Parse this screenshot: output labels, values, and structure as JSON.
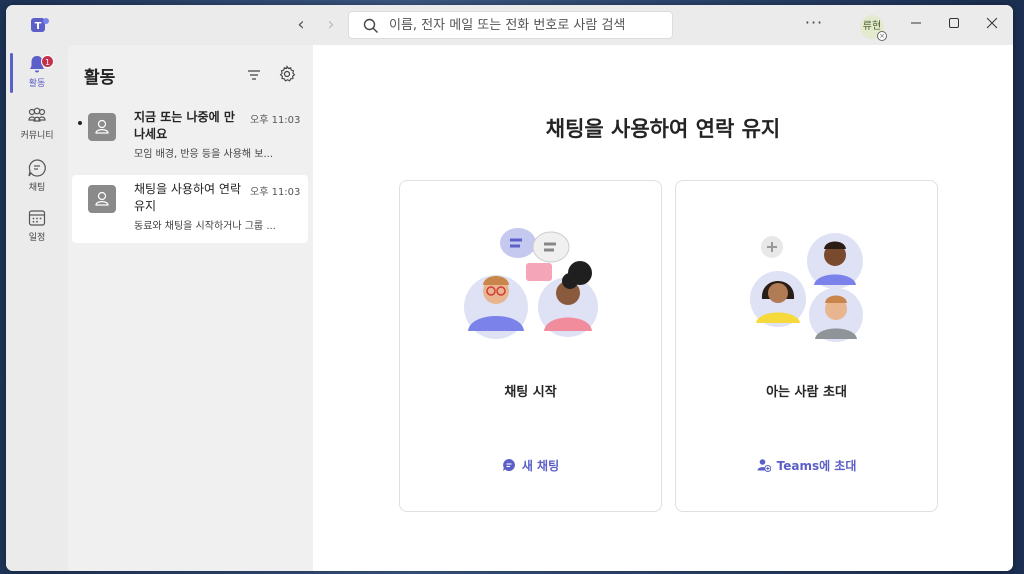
{
  "titlebar": {
    "search_placeholder": "이름, 전자 메일 또는 전화 번호로 사람 검색",
    "more_label": "···",
    "avatar_initials": "류현"
  },
  "rail": {
    "items": [
      {
        "label": "활동",
        "icon": "bell-icon",
        "badge": "1",
        "active": true
      },
      {
        "label": "커뮤니티",
        "icon": "community-icon"
      },
      {
        "label": "채팅",
        "icon": "chat-icon"
      },
      {
        "label": "일정",
        "icon": "calendar-icon"
      }
    ]
  },
  "activity": {
    "title": "활동",
    "items": [
      {
        "title": "지금 또는 나중에 만나세요",
        "time": "오후 11:03",
        "preview": "모임 배경, 반응 등을 사용해 보...",
        "unread": true
      },
      {
        "title": "채팅을 사용하여 연락 유지",
        "time": "오후 11:03",
        "preview": "동료와 채팅을 시작하거나 그룹 ...",
        "selected": true
      }
    ]
  },
  "main": {
    "heading": "채팅을 사용하여 연락 유지",
    "cards": [
      {
        "title": "채팅 시작",
        "action": "새 채팅"
      },
      {
        "title": "아는 사람 초대",
        "action": "Teams에 초대"
      }
    ]
  },
  "colors": {
    "accent": "#5b5fc7",
    "badge": "#c4314b",
    "background": "#ebebeb"
  }
}
